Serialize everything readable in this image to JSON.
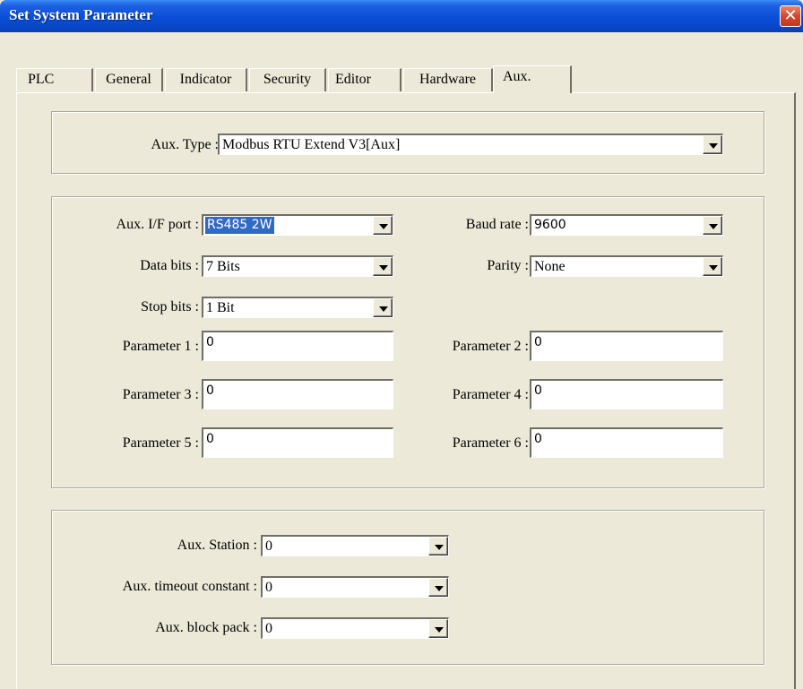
{
  "window": {
    "title": "Set System Parameter",
    "close_glyph": "✕"
  },
  "tabs": [
    {
      "label": "PLC"
    },
    {
      "label": "General"
    },
    {
      "label": "Indicator"
    },
    {
      "label": "Security"
    },
    {
      "label": "Editor"
    },
    {
      "label": "Hardware"
    },
    {
      "label": "Aux."
    }
  ],
  "active_tab": "Aux.",
  "aux_type": {
    "label": "Aux. Type :",
    "value": "Modbus RTU Extend V3[Aux]"
  },
  "comm": {
    "port": {
      "label": "Aux. I/F port :",
      "value": "RS485 2W"
    },
    "baud": {
      "label": "Baud rate :",
      "value": "9600"
    },
    "data_bits": {
      "label": "Data bits :",
      "value": "7 Bits"
    },
    "parity": {
      "label": "Parity :",
      "value": "None"
    },
    "stop_bits": {
      "label": "Stop bits :",
      "value": "1 Bit"
    },
    "params": [
      {
        "label": "Parameter 1 :",
        "value": "0"
      },
      {
        "label": "Parameter 2 :",
        "value": "0"
      },
      {
        "label": "Parameter 3 :",
        "value": "0"
      },
      {
        "label": "Parameter 4 :",
        "value": "0"
      },
      {
        "label": "Parameter 5 :",
        "value": "0"
      },
      {
        "label": "Parameter 6 :",
        "value": "0"
      }
    ]
  },
  "station": {
    "station": {
      "label": "Aux. Station :",
      "value": "0"
    },
    "timeout": {
      "label": "Aux. timeout constant :",
      "value": "0"
    },
    "block_pack": {
      "label": "Aux. block pack :",
      "value": "0"
    }
  },
  "colors": {
    "title_bar": "#0a4fd8",
    "close_button": "#d5482c",
    "dialog_bg": "#ece9d8",
    "selection": "#316ac5"
  },
  "icons": {
    "close": "close-icon",
    "dropdown": "chevron-down-icon"
  }
}
